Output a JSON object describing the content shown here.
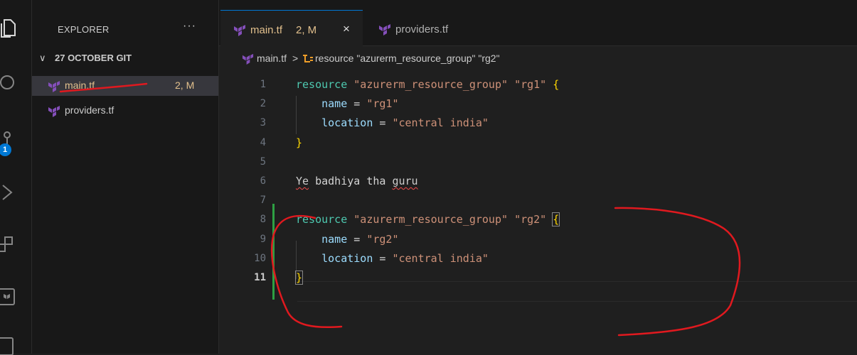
{
  "sidebar": {
    "title": "EXPLORER",
    "more": "···",
    "folder": "27 OCTOBER GIT",
    "files": [
      {
        "name": "main.tf",
        "badge": "2, M"
      },
      {
        "name": "providers.tf",
        "badge": ""
      }
    ]
  },
  "activity": {
    "icons": [
      "explorer-icon",
      "search-icon",
      "source-control-icon",
      "run-debug-icon",
      "extensions-icon",
      "terraform-icon",
      "testing-icon"
    ],
    "source_control_badge": "1"
  },
  "tabs": [
    {
      "name": "main.tf",
      "status": "2, M",
      "close": "×"
    },
    {
      "name": "providers.tf"
    }
  ],
  "breadcrumb": {
    "file": "main.tf",
    "separator": ">",
    "symbol": "resource \"azurerm_resource_group\" \"rg2\""
  },
  "editor": {
    "lines": [
      {
        "n": "1",
        "tokens": [
          [
            "kw",
            "resource"
          ],
          [
            "plain",
            " "
          ],
          [
            "str",
            "\"azurerm_resource_group\""
          ],
          [
            "plain",
            " "
          ],
          [
            "str",
            "\"rg1\""
          ],
          [
            "plain",
            " "
          ],
          [
            "brace",
            "{"
          ]
        ]
      },
      {
        "n": "2",
        "tokens": [
          [
            "plain",
            "    "
          ],
          [
            "prop",
            "name"
          ],
          [
            "plain",
            " = "
          ],
          [
            "str",
            "\"rg1\""
          ]
        ]
      },
      {
        "n": "3",
        "tokens": [
          [
            "plain",
            "    "
          ],
          [
            "prop",
            "location"
          ],
          [
            "plain",
            " = "
          ],
          [
            "str",
            "\"central india\""
          ]
        ]
      },
      {
        "n": "4",
        "tokens": [
          [
            "brace",
            "}"
          ]
        ]
      },
      {
        "n": "5",
        "tokens": []
      },
      {
        "n": "6",
        "tokens": [
          [
            "squig",
            "Ye"
          ],
          [
            "plain",
            " badhiya tha "
          ],
          [
            "squig",
            "guru"
          ]
        ]
      },
      {
        "n": "7",
        "tokens": []
      },
      {
        "n": "8",
        "tokens": [
          [
            "kw",
            "resource"
          ],
          [
            "plain",
            " "
          ],
          [
            "str",
            "\"azurerm_resource_group\""
          ],
          [
            "plain",
            " "
          ],
          [
            "str",
            "\"rg2\""
          ],
          [
            "plain",
            " "
          ],
          [
            "bracehl",
            "{"
          ]
        ]
      },
      {
        "n": "9",
        "tokens": [
          [
            "plain",
            "    "
          ],
          [
            "prop",
            "name"
          ],
          [
            "plain",
            " = "
          ],
          [
            "str",
            "\"rg2\""
          ]
        ]
      },
      {
        "n": "10",
        "tokens": [
          [
            "plain",
            "    "
          ],
          [
            "prop",
            "location"
          ],
          [
            "plain",
            " = "
          ],
          [
            "str",
            "\"central india\""
          ]
        ]
      },
      {
        "n": "11",
        "tokens": [
          [
            "bracehl",
            "}"
          ]
        ]
      }
    ],
    "current_line": "11"
  },
  "colors": {
    "keyword": "#4ec9b0",
    "string": "#ce9178",
    "property": "#9cdcfe",
    "brace": "#ffd700",
    "git_added": "#2ea043",
    "annotation": "#e0191f",
    "modified": "#e2c08d"
  }
}
